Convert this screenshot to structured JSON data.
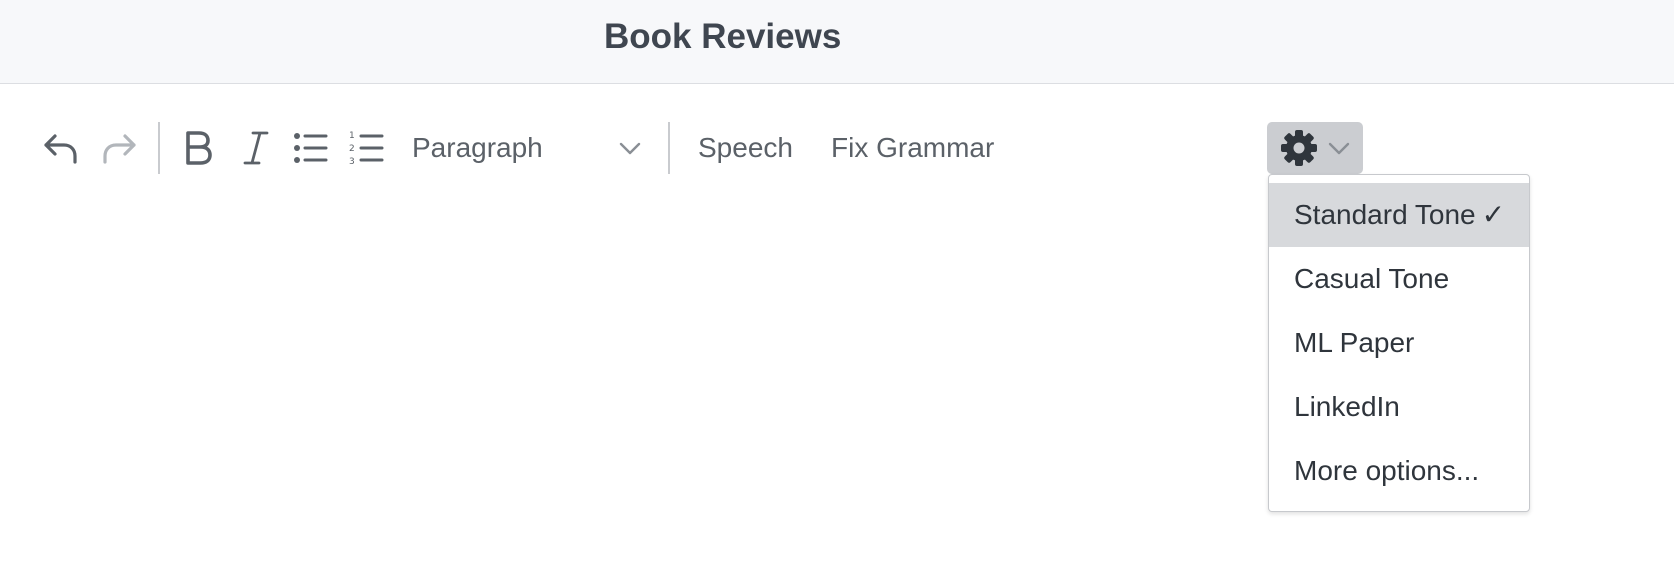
{
  "header": {
    "title": "Book Reviews"
  },
  "toolbar": {
    "undo_icon": "undo-icon",
    "redo_icon": "redo-icon",
    "bold_icon": "bold-icon",
    "italic_icon": "italic-icon",
    "bulleted_list_icon": "bulleted-list-icon",
    "numbered_list_icon": "numbered-list-icon",
    "block_format": {
      "selected": "Paragraph"
    },
    "speech_label": "Speech",
    "fix_grammar_label": "Fix Grammar",
    "settings_icon": "gear-icon",
    "redo_enabled": false
  },
  "tone_menu": {
    "items": [
      {
        "label": "Standard Tone",
        "checkmark": "✓",
        "selected": true
      },
      {
        "label": "Casual Tone",
        "checkmark": "",
        "selected": false
      },
      {
        "label": "ML Paper",
        "checkmark": "",
        "selected": false
      },
      {
        "label": "LinkedIn",
        "checkmark": "",
        "selected": false
      },
      {
        "label": "More options...",
        "checkmark": "",
        "selected": false
      }
    ]
  },
  "colors": {
    "header_bg": "#f7f8fa",
    "toolbar_icon": "#5b6168",
    "disabled_icon": "#b2b6bb",
    "settings_button_bg": "#cbcdd1",
    "selected_item_bg": "#d7d9dc"
  }
}
